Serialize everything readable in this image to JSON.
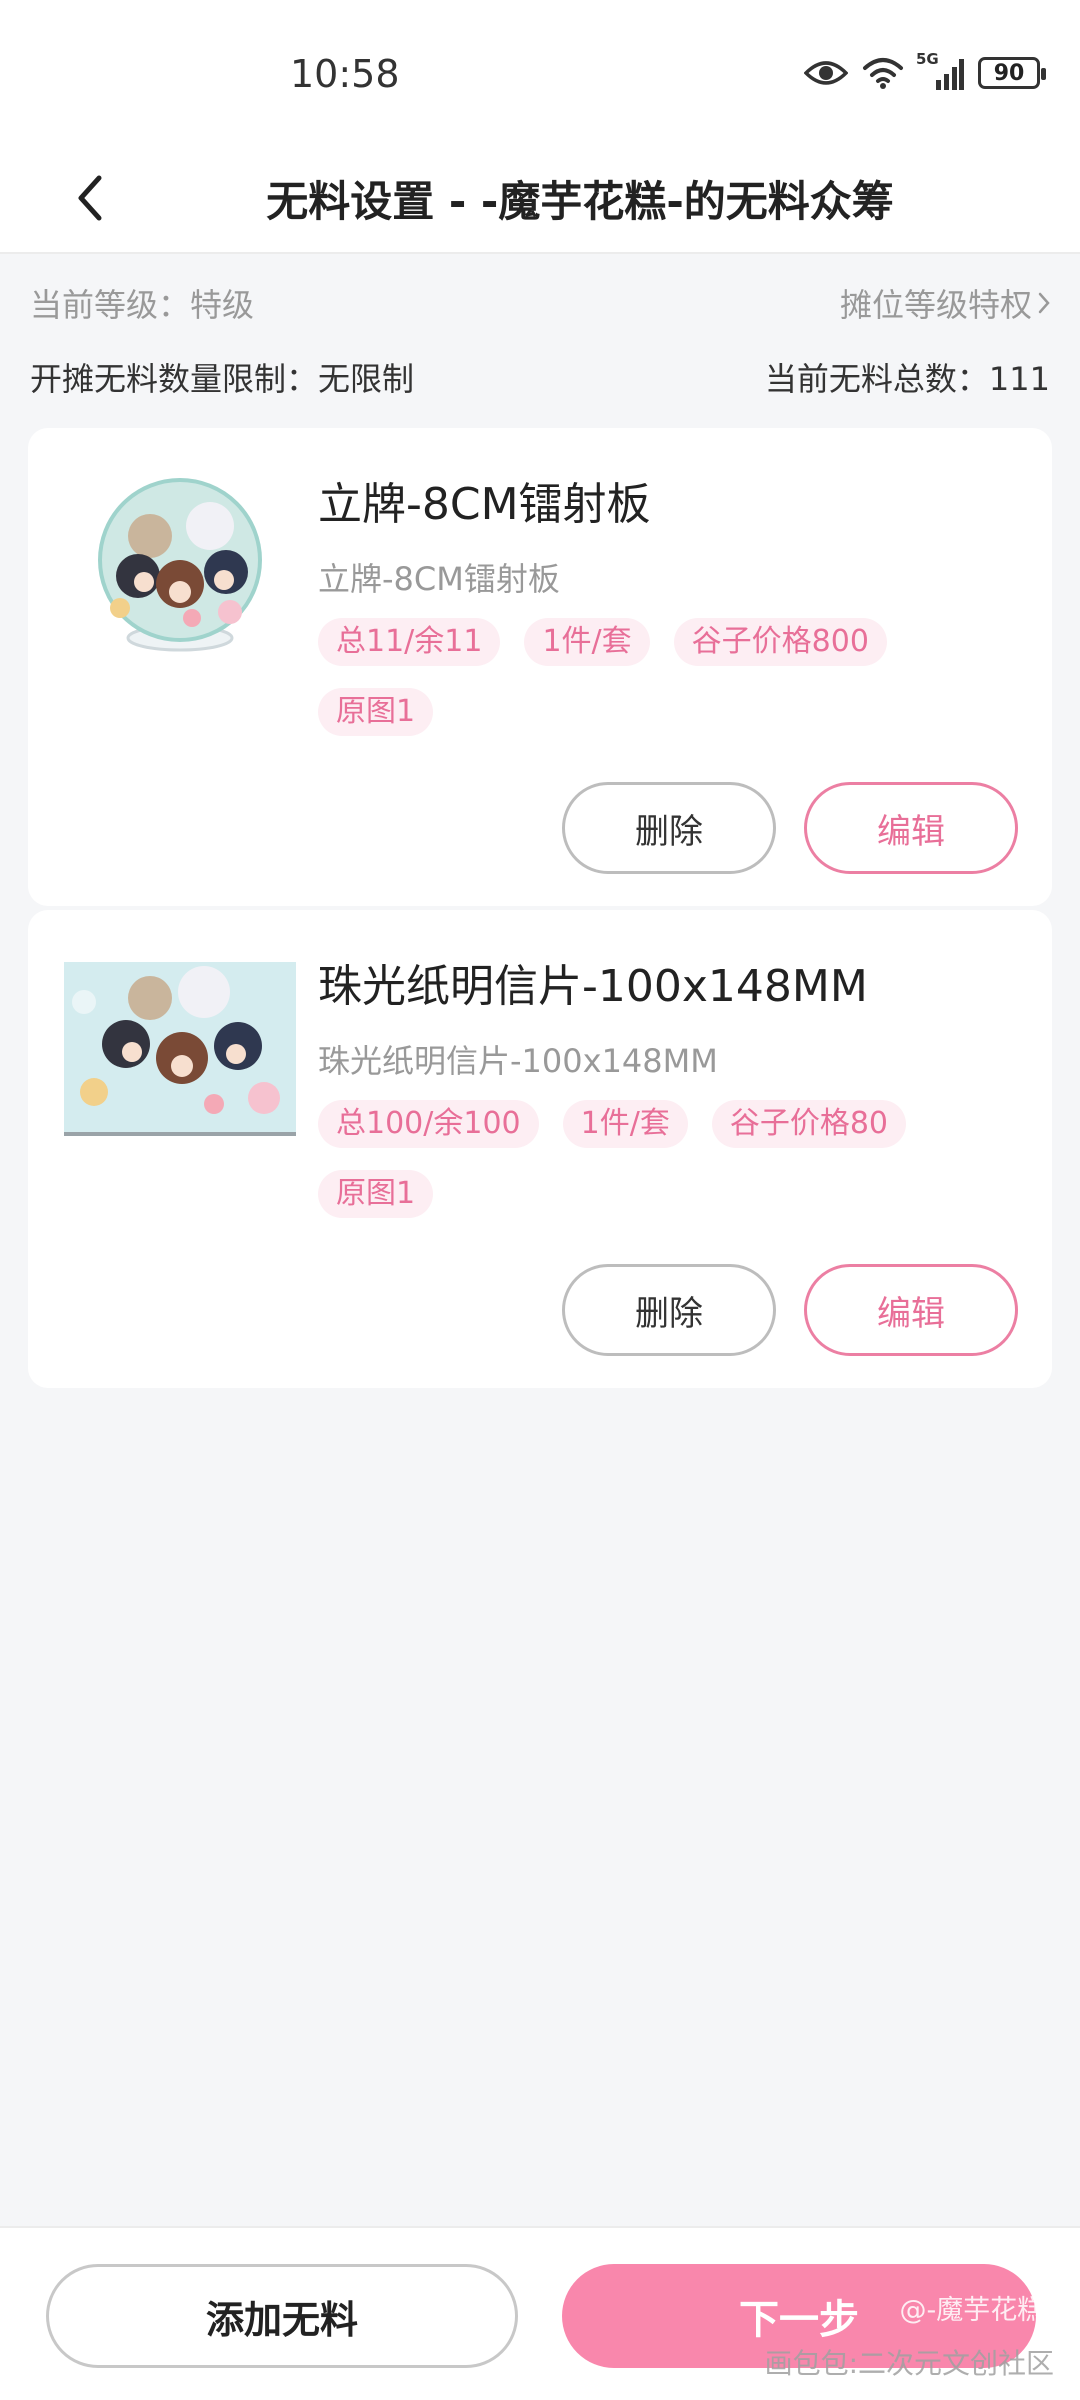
{
  "status_bar": {
    "time": "10:58",
    "network": "5G",
    "battery": "90",
    "icons": [
      "eye-icon",
      "wifi-icon",
      "signal-icon",
      "battery-icon"
    ]
  },
  "nav": {
    "back_icon": "chevron-left-icon",
    "title": "无料设置 - -魔芋花糕-的无料众筹"
  },
  "info": {
    "level_label": "当前等级：特级",
    "privilege_link": "摊位等级特权",
    "limit_label": "开摊无料数量限制：无限制",
    "total_label": "当前无料总数：111"
  },
  "items": [
    {
      "title": "立牌-8CM镭射板",
      "subtitle": "立牌-8CM镭射板",
      "tags": [
        "总11/余11",
        "1件/套",
        "谷子价格800",
        "原图1"
      ],
      "delete_label": "删除",
      "edit_label": "编辑"
    },
    {
      "title": "珠光纸明信片-100x148MM",
      "subtitle": "珠光纸明信片-100x148MM",
      "tags": [
        "总100/余100",
        "1件/套",
        "谷子价格80",
        "原图1"
      ],
      "delete_label": "删除",
      "edit_label": "编辑"
    }
  ],
  "bottom": {
    "add_label": "添加无料",
    "next_label": "下一步"
  },
  "watermark": {
    "author": "@-魔芋花糕-",
    "site": "画包包:二次元文创社区"
  },
  "colors": {
    "accent": "#f987ac",
    "tag_bg": "#fdeef3",
    "tag_text": "#e86f98",
    "background": "#f5f6f8"
  }
}
